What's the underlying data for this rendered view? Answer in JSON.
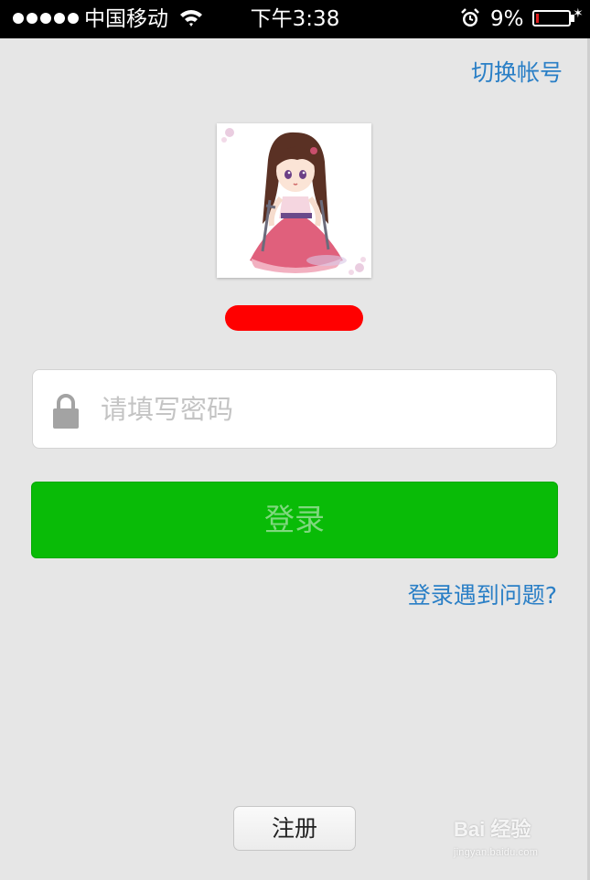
{
  "status_bar": {
    "signal_dots": 5,
    "carrier": "中国移动",
    "time": "下午3:38",
    "battery_percent": "9%",
    "battery_level": 0.09,
    "battery_color": "#e01e1e"
  },
  "header": {
    "switch_account_label": "切换帐号"
  },
  "profile": {
    "name_redacted_color": "#ff0000"
  },
  "login_form": {
    "password_placeholder": "请填写密码",
    "password_value": "",
    "login_label": "登录",
    "login_color": "#09bb07",
    "help_link": "登录遇到问题?"
  },
  "footer": {
    "register_label": "注册"
  },
  "watermark": {
    "brand": "Bai 经验",
    "url": "jingyan.baidu.com"
  },
  "colors": {
    "link": "#2a7fc6",
    "background": "#e6e6e6"
  }
}
